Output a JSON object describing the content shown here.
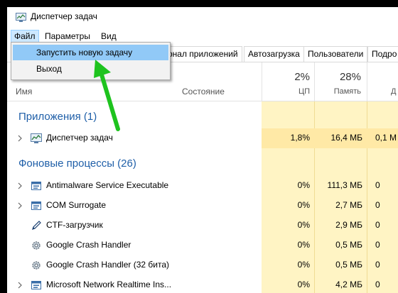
{
  "window": {
    "title": "Диспетчер задач"
  },
  "menu": {
    "file": "Файл",
    "params": "Параметры",
    "view": "Вид"
  },
  "file_menu": {
    "items": [
      "Запустить новую задачу",
      "Выход"
    ]
  },
  "tabs": [
    "рнал приложений",
    "Автозагрузка",
    "Пользователи",
    "Подро"
  ],
  "header": {
    "name": "Имя",
    "state": "Состояние",
    "cpu_pct": "2%",
    "cpu_label": "ЦП",
    "mem_pct": "28%",
    "mem_label": "Память",
    "disk_label": "Д"
  },
  "groups": {
    "apps": "Приложения (1)",
    "background": "Фоновые процессы (26)"
  },
  "apps": [
    {
      "name": "Диспетчер задач",
      "cpu": "1,8%",
      "mem": "16,4 МБ",
      "disk": "0,1 М",
      "icon": "taskmgr-icon"
    }
  ],
  "background": [
    {
      "name": "Antimalware Service Executable",
      "cpu": "0%",
      "mem": "111,3 МБ",
      "disk": "0",
      "icon": "service-icon",
      "expandable": true
    },
    {
      "name": "COM Surrogate",
      "cpu": "0%",
      "mem": "2,7 МБ",
      "disk": "0",
      "icon": "service-icon",
      "expandable": true
    },
    {
      "name": "CTF-загрузчик",
      "cpu": "0%",
      "mem": "2,9 МБ",
      "disk": "0",
      "icon": "pen-icon",
      "expandable": false
    },
    {
      "name": "Google Crash Handler",
      "cpu": "0%",
      "mem": "0,5 МБ",
      "disk": "0",
      "icon": "gear-icon",
      "expandable": false
    },
    {
      "name": "Google Crash Handler (32 бита)",
      "cpu": "0%",
      "mem": "0,5 МБ",
      "disk": "0",
      "icon": "gear-icon",
      "expandable": false
    },
    {
      "name": "Microsoft Network Realtime Ins...",
      "cpu": "0%",
      "mem": "4,2 МБ",
      "disk": "0",
      "icon": "service-icon",
      "expandable": true
    }
  ],
  "colors": {
    "accent": "#1f5fa8",
    "highlight": "#fff4c4",
    "selection": "#91c9f7"
  }
}
